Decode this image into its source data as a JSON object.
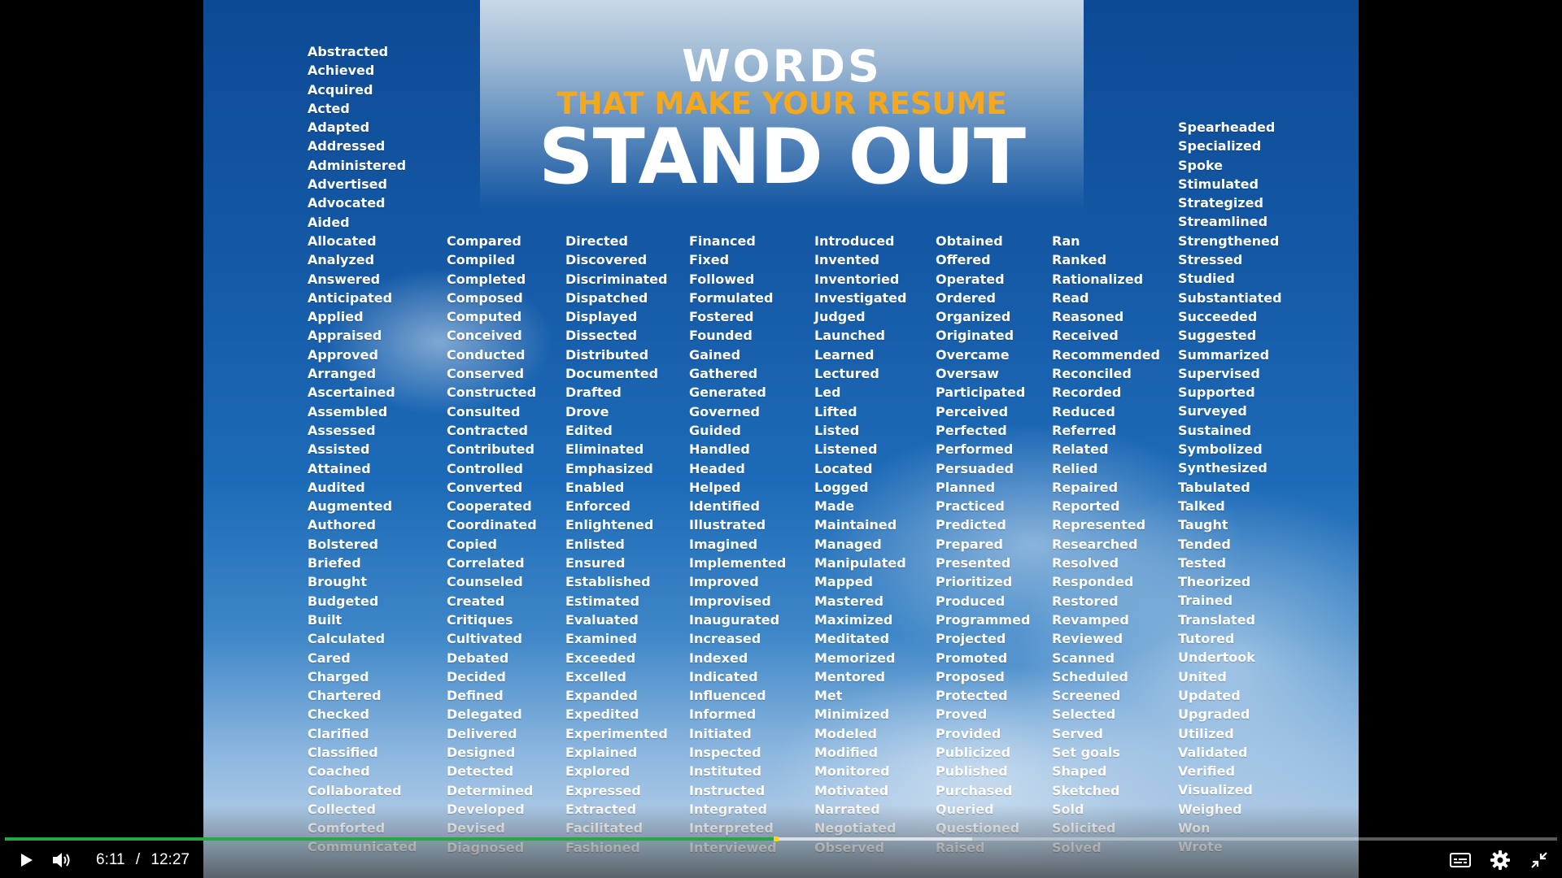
{
  "title": {
    "line1": "WORDS",
    "line2": "THAT MAKE YOUR RESUME",
    "line3": "STAND OUT"
  },
  "columns": [
    [
      "Abstracted",
      "Achieved",
      "Acquired",
      "Acted",
      "Adapted",
      "Addressed",
      "Administered",
      "Advertised",
      "Advocated",
      "Aided",
      "Allocated",
      "Analyzed",
      "Answered",
      "Anticipated",
      "Applied",
      "Appraised",
      "Approved",
      "Arranged",
      "Ascertained",
      "Assembled",
      "Assessed",
      "Assisted",
      "Attained",
      "Audited",
      "Augmented",
      "Authored",
      "Bolstered",
      "Briefed",
      "Brought",
      "Budgeted",
      "Built",
      "Calculated",
      "Cared",
      "Charged",
      "Chartered",
      "Checked",
      "Clarified",
      "Classified",
      "Coached",
      "Collaborated",
      "Collected",
      "Comforted",
      "Communicated"
    ],
    [
      "Compared",
      "Compiled",
      "Completed",
      "Composed",
      "Computed",
      "Conceived",
      "Conducted",
      "Conserved",
      "Constructed",
      "Consulted",
      "Contracted",
      "Contributed",
      "Controlled",
      "Converted",
      "Cooperated",
      "Coordinated",
      "Copied",
      "Correlated",
      "Counseled",
      "Created",
      "Critiques",
      "Cultivated",
      "Debated",
      "Decided",
      "Defined",
      "Delegated",
      "Delivered",
      "Designed",
      "Detected",
      "Determined",
      "Developed",
      "Devised",
      "Diagnosed"
    ],
    [
      "Directed",
      "Discovered",
      "Discriminated",
      "Dispatched",
      "Displayed",
      "Dissected",
      "Distributed",
      "Documented",
      "Drafted",
      "Drove",
      "Edited",
      "Eliminated",
      "Emphasized",
      "Enabled",
      "Enforced",
      "Enlightened",
      "Enlisted",
      "Ensured",
      "Established",
      "Estimated",
      "Evaluated",
      "Examined",
      "Exceeded",
      "Excelled",
      "Expanded",
      "Expedited",
      "Experimented",
      "Explained",
      "Explored",
      "Expressed",
      "Extracted",
      "Facilitated",
      "Fashioned"
    ],
    [
      "Financed",
      "Fixed",
      "Followed",
      "Formulated",
      "Fostered",
      "Founded",
      "Gained",
      "Gathered",
      "Generated",
      "Governed",
      "Guided",
      "Handled",
      "Headed",
      "Helped",
      "Identified",
      "Illustrated",
      "Imagined",
      "Implemented",
      "Improved",
      "Improvised",
      "Inaugurated",
      "Increased",
      "Indexed",
      "Indicated",
      "Influenced",
      "Informed",
      "Initiated",
      "Inspected",
      "Instituted",
      "Instructed",
      "Integrated",
      "Interpreted",
      "Interviewed"
    ],
    [
      "Introduced",
      "Invented",
      "Inventoried",
      "Investigated",
      "Judged",
      "Launched",
      "Learned",
      "Lectured",
      "Led",
      "Lifted",
      "Listed",
      "Listened",
      "Located",
      "Logged",
      "Made",
      "Maintained",
      "Managed",
      "Manipulated",
      "Mapped",
      "Mastered",
      "Maximized",
      "Meditated",
      "Memorized",
      "Mentored",
      "Met",
      "Minimized",
      "Modeled",
      "Modified",
      "Monitored",
      "Motivated",
      "Narrated",
      "Negotiated",
      "Observed"
    ],
    [
      "Obtained",
      "Offered",
      "Operated",
      "Ordered",
      "Organized",
      "Originated",
      "Overcame",
      "Oversaw",
      "Participated",
      "Perceived",
      "Perfected",
      "Performed",
      "Persuaded",
      "Planned",
      "Practiced",
      "Predicted",
      "Prepared",
      "Presented",
      "Prioritized",
      "Produced",
      "Programmed",
      "Projected",
      "Promoted",
      "Proposed",
      "Protected",
      "Proved",
      "Provided",
      "Publicized",
      "Published",
      "Purchased",
      "Queried",
      "Questioned",
      "Raised"
    ],
    [
      "Ran",
      "Ranked",
      "Rationalized",
      "Read",
      "Reasoned",
      "Received",
      "Recommended",
      "Reconciled",
      "Recorded",
      "Reduced",
      "Referred",
      "Related",
      "Relied",
      "Repaired",
      "Reported",
      "Represented",
      "Researched",
      "Resolved",
      "Responded",
      "Restored",
      "Revamped",
      "Reviewed",
      "Scanned",
      "Scheduled",
      "Screened",
      "Selected",
      "Served",
      "Set goals",
      "Shaped",
      "Sketched",
      "Sold",
      "Solicited",
      "Solved"
    ],
    [
      "Spearheaded",
      "Specialized",
      "Spoke",
      "Stimulated",
      "Strategized",
      "Streamlined",
      "Strengthened",
      "Stressed",
      "Studied",
      "Substantiated",
      "Succeeded",
      "Suggested",
      "Summarized",
      "Supervised",
      "Supported",
      "Surveyed",
      "Sustained",
      "Symbolized",
      "Synthesized",
      "Tabulated",
      "Talked",
      "Taught",
      "Tended",
      "Tested",
      "Theorized",
      "Trained",
      "Translated",
      "Tutored",
      "Undertook",
      "United",
      "Updated",
      "Upgraded",
      "Utilized",
      "Validated",
      "Verified",
      "Visualized",
      "Weighed",
      "Won",
      "Wrote"
    ]
  ],
  "player": {
    "current_time": "6:11",
    "separator": "/",
    "duration": "12:27",
    "progress_fraction": 0.497,
    "buffered_fraction": 0.623,
    "accent_color": "#28a745",
    "scrub_color": "#ffd21f",
    "icons": [
      "play-icon",
      "volume-icon",
      "captions-icon",
      "settings-icon",
      "exit-fullscreen-icon"
    ]
  }
}
